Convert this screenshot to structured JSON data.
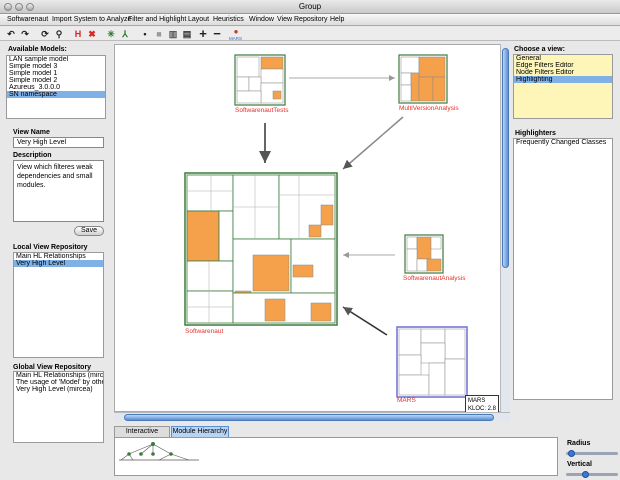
{
  "window": {
    "title": "Group"
  },
  "menu": [
    "Softwarenaut",
    "Import System to Analyze",
    "Filter and Highlight",
    "Layout",
    "Heuristics",
    "Window",
    "View Repository",
    "Help"
  ],
  "toolbar": {
    "icons": [
      "undo-icon",
      "redo-icon",
      "rotate-icon",
      "magic-wand-icon",
      "h-icon",
      "x-icon",
      "star-icon",
      "tree-icon",
      "dot-icon",
      "gray-square-icon",
      "layers-icon",
      "dark-layers-icon",
      "plus-icon",
      "minus-icon",
      "mars-icon"
    ],
    "mars_label": "MARS"
  },
  "available_models": {
    "title": "Available Models:",
    "items": [
      "LAN sample model",
      "Simple model 3",
      "Simple model 1",
      "Simple model 2",
      "Azureus_3.0.0.0",
      "SN namespace"
    ],
    "selected_index": 5
  },
  "view_form": {
    "name_label": "View Name",
    "name_value": "Very High Level",
    "description_label": "Description",
    "description_value": "View which filteres weak dependencies and small modules.",
    "save_label": "Save"
  },
  "local_repo": {
    "title": "Local View Repository",
    "items": [
      "Main HL Relationships",
      "Very High Level"
    ],
    "selected_index": 1
  },
  "global_repo": {
    "title": "Global View Repository",
    "items": [
      "Main HL Relationships (mirce",
      "The usage of 'Model' by other",
      "Very High Level (mircea)"
    ]
  },
  "canvas": {
    "nodes": {
      "tests": "SoftwarenautTests",
      "multi": "MultiVersionAnalysis",
      "analysis": "SoftwarenautAnalysis",
      "main": "Softwarenaut",
      "mars": "MARS"
    },
    "tooltip": {
      "name": "MARS",
      "kloc": "KLOC: 2.8"
    },
    "colors": {
      "highlight": "#f5a04a",
      "border_green": "#3c7a3c",
      "border_blue": "#6f6fd6",
      "label_red": "#e8302a"
    }
  },
  "bottom": {
    "tabs": [
      "Interactive Coding",
      "Module Hierarchy"
    ],
    "active_tab": 1,
    "radius_label": "Radius",
    "vertical_label": "Vertical"
  },
  "right": {
    "choose_view_title": "Choose a view:",
    "views": [
      "General",
      "Edge Filters Editor",
      "Node Filters Editor",
      "Highlighting"
    ],
    "selected_view": 3,
    "highlighters_title": "Highlighters",
    "highlighters": [
      "Frequently Changed Classes"
    ]
  }
}
